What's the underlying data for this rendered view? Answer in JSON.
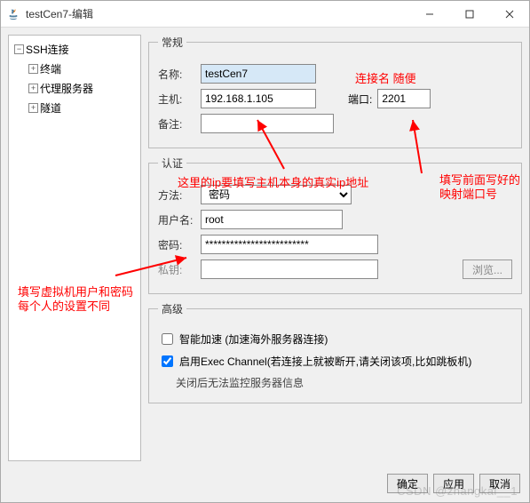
{
  "window": {
    "title": "testCen7-编辑"
  },
  "sidebar": {
    "root": "SSH连接",
    "items": [
      "终端",
      "代理服务器",
      "隧道"
    ]
  },
  "general": {
    "legend": "常规",
    "name_label": "名称:",
    "name_value": "testCen7",
    "host_label": "主机:",
    "host_value": "192.168.1.105",
    "port_label": "端口:",
    "port_value": "2201",
    "remark_label": "备注:",
    "remark_value": ""
  },
  "auth": {
    "legend": "认证",
    "method_label": "方法:",
    "method_value": "密码",
    "user_label": "用户名:",
    "user_value": "root",
    "password_label": "密码:",
    "password_value": "*************************",
    "key_label": "私钥:",
    "key_value": "",
    "browse_label": "浏览..."
  },
  "advanced": {
    "legend": "高级",
    "speed_label": "智能加速 (加速海外服务器连接)",
    "speed_checked": false,
    "exec_label": "启用Exec Channel(若连接上就被断开,请关闭该项,比如跳板机)",
    "exec_checked": true,
    "exec_note": "关闭后无法监控服务器信息"
  },
  "buttons": {
    "ok": "确定",
    "apply": "应用",
    "cancel": "取消"
  },
  "annotations": {
    "conn_name": "连接名 随便",
    "ip_note": "这里的ip要填写主机本身的真实ip地址",
    "port_note": "填写前面写好的映射端口号",
    "user_note1": "填写虚拟机用户和密码",
    "user_note2": "每个人的设置不同"
  },
  "watermark": "CSDN @zhangkai__1"
}
